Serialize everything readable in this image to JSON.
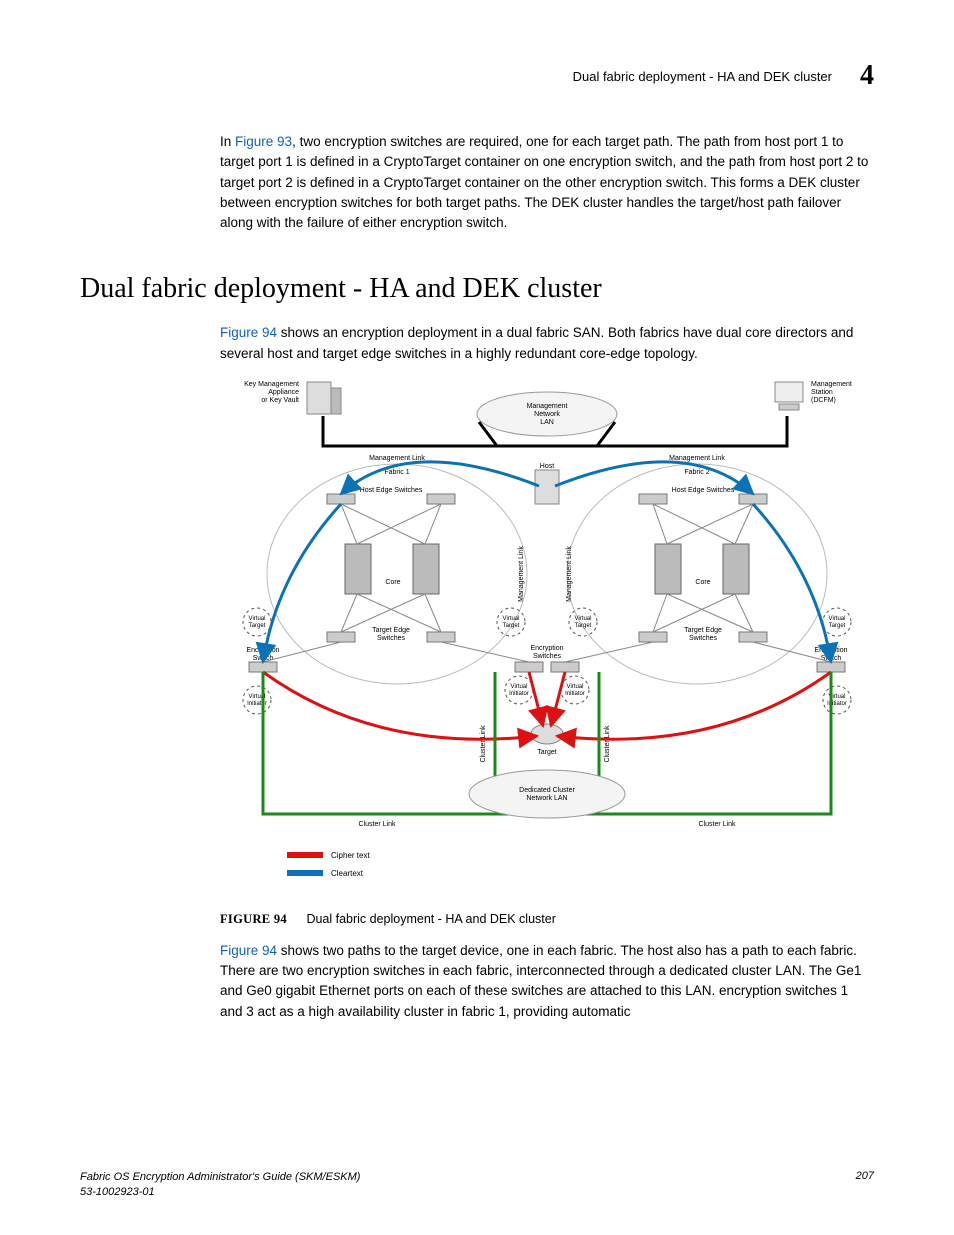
{
  "header": {
    "running_title": "Dual fabric deployment - HA and DEK cluster",
    "chapter_number": "4"
  },
  "intro_paragraph": {
    "lead_link": "Figure 93",
    "prefix": "In ",
    "text_after": ", two encryption switches are required, one for each target path. The path from host port 1 to target port 1 is defined in a CryptoTarget container on one encryption switch, and the path from host port 2 to target port 2 is defined in a CryptoTarget container on the other encryption switch. This forms a DEK cluster between encryption switches for both target paths. The DEK cluster handles the target/host path failover along with the failure of either encryption switch."
  },
  "section": {
    "title": "Dual fabric deployment - HA and DEK cluster",
    "para1": {
      "link": "Figure 94",
      "text_after": " shows an encryption deployment in a dual fabric SAN. Both fabrics have dual core directors and several host and target edge switches in a highly redundant core-edge topology."
    },
    "figure": {
      "label": "FIGURE 94",
      "caption": "Dual fabric deployment - HA and DEK cluster",
      "labels": {
        "key_mgmt": "Key Management\nAppliance\nor Key Vault",
        "mgmt_station": "Management\nStation\n(DCFM)",
        "mgmt_lan": "Management\nNetwork\nLAN",
        "mgmt_link_l": "Management Link",
        "mgmt_link_r": "Management Link",
        "fabric1": "Fabric 1",
        "fabric2": "Fabric 2",
        "host": "Host",
        "host_edge_l": "Host Edge Switches",
        "host_edge_r": "Host Edge Switches",
        "core_l": "Core",
        "core_r": "Core",
        "target_edge_l": "Target Edge\nSwitches",
        "target_edge_r": "Target Edge\nSwitches",
        "virt_target": "Virtual\nTarget",
        "virt_initiator": "Virtual\nInitiator",
        "enc_switch": "Encryption\nSwitch",
        "enc_switches": "Encryption\nSwitches",
        "target": "Target",
        "dedicated_lan": "Dedicated Cluster\nNetwork LAN",
        "cluster_link": "Cluster Link",
        "mgmt_link_v": "Management Link",
        "legend_cipher": "Cipher text",
        "legend_clear": "Cleartext"
      }
    },
    "para2": {
      "link": "Figure 94",
      "text_after": " shows two paths to the target device, one in each fabric. The host also has a path to each fabric. There are two encryption switches in each fabric, interconnected through a dedicated cluster LAN. The Ge1 and Ge0 gigabit Ethernet ports on each of these switches are attached to this LAN. encryption switches 1 and 3 act as a high availability cluster in fabric 1, providing automatic"
    }
  },
  "footer": {
    "book": "Fabric OS Encryption Administrator's Guide (SKM/ESKM)",
    "docnum": "53-1002923-01",
    "page": "207"
  }
}
